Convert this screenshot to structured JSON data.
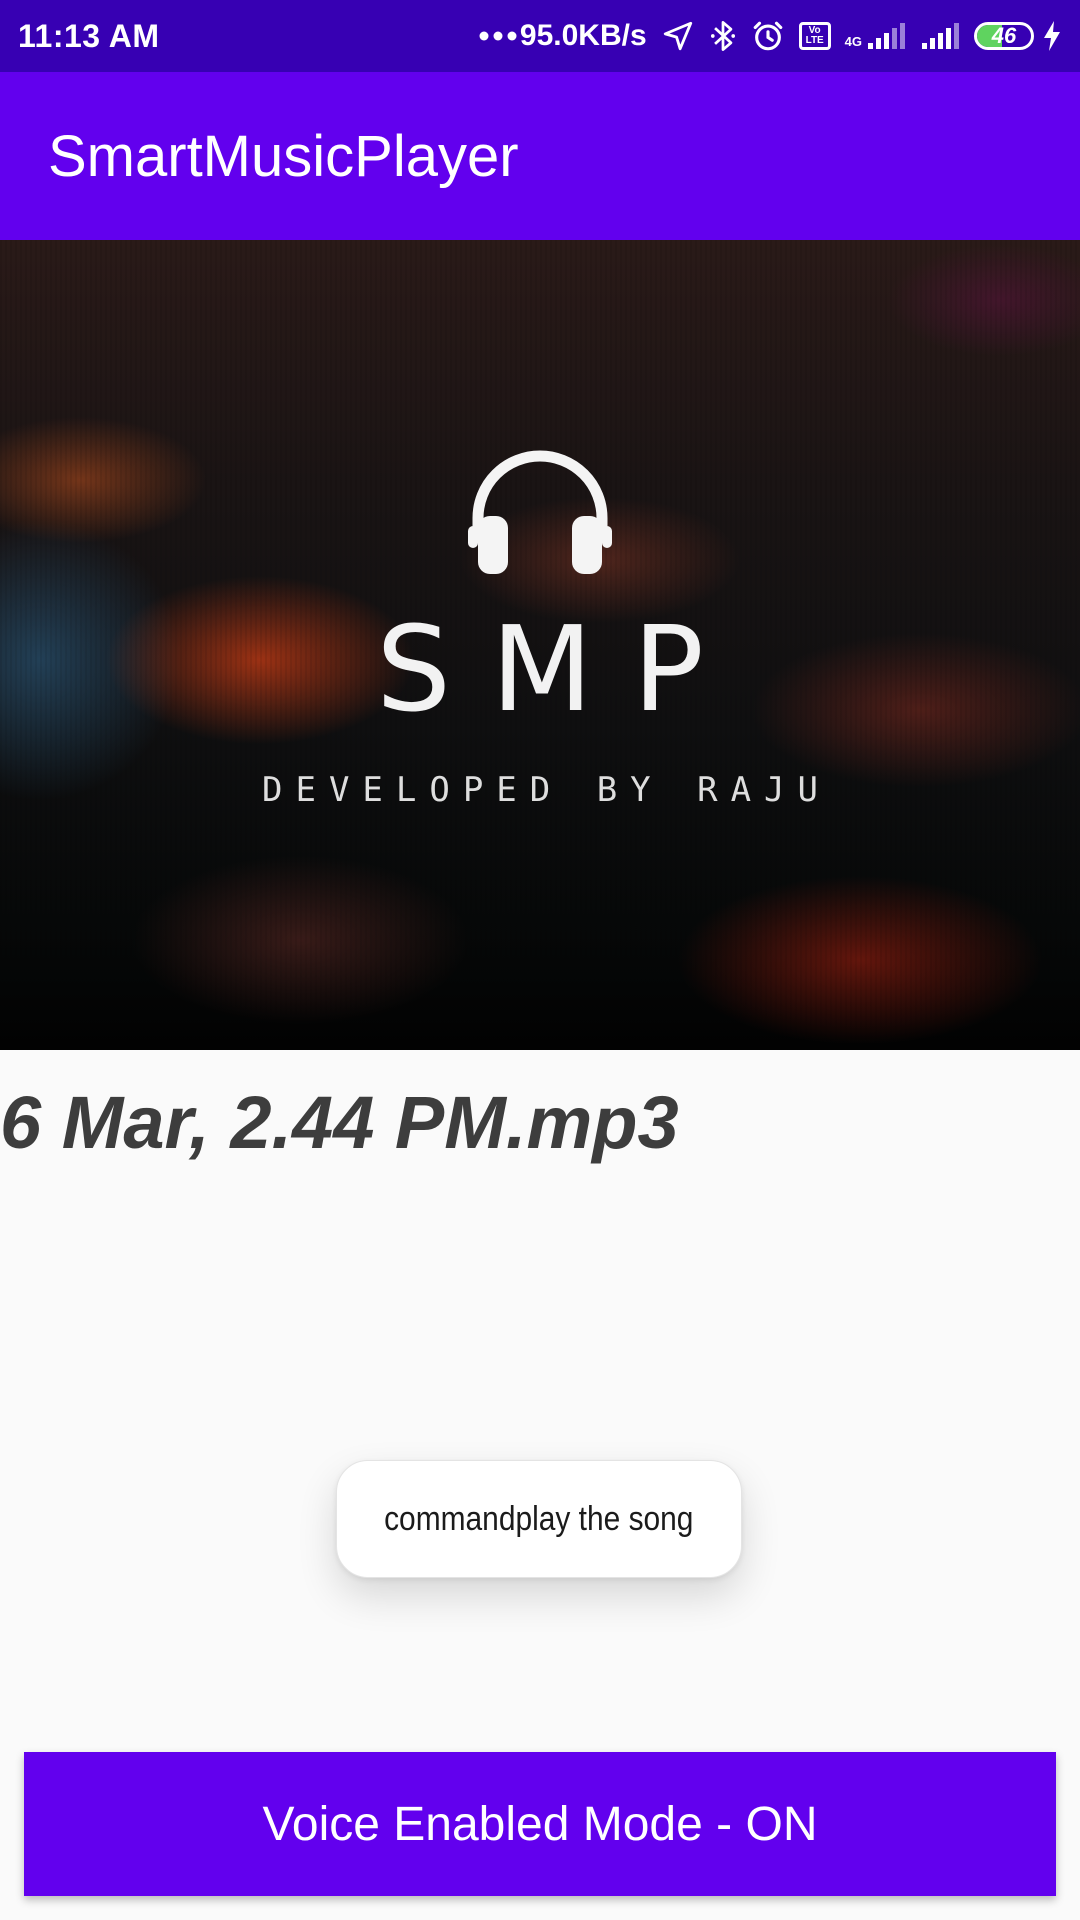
{
  "status_bar": {
    "time": "11:13 AM",
    "network_speed": "95.0KB/s",
    "volte_top": "Vo",
    "volte_bottom": "LTE",
    "network_type": "4G",
    "battery_level": "46",
    "battery_fraction": 0.46,
    "icons": [
      "more-dots-icon",
      "location-arrow-icon",
      "bluetooth-icon",
      "alarm-icon",
      "volte-icon",
      "signal-4g-icon",
      "signal-icon",
      "battery-icon",
      "charging-icon"
    ]
  },
  "app_bar": {
    "title": "SmartMusicPlayer"
  },
  "banner": {
    "logo_text": "SMP",
    "developer_text": "DEVELOPED BY RAJU",
    "icon": "headphones-icon"
  },
  "player": {
    "song_title": "6 Mar, 2.44 PM.mp3"
  },
  "toast": {
    "message": "commandplay the song"
  },
  "voice_button": {
    "label": "Voice Enabled Mode - ON"
  },
  "colors": {
    "status_bar": "#3700b3",
    "primary": "#6200ee",
    "background": "#fafafa",
    "song_title": "#3d3d3d",
    "battery_fill": "#5fd35f"
  }
}
